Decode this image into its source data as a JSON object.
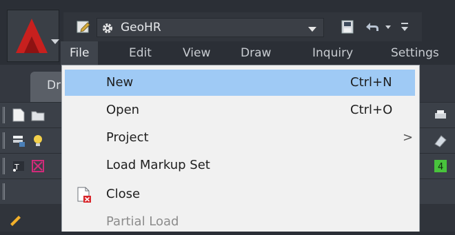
{
  "app": {
    "logo_icon": "autocad-a-icon",
    "accent_color": "#c8201e"
  },
  "quick_access": {
    "workspace": "GeoHR",
    "icons": [
      "document-edit-icon",
      "gear-icon",
      "save-icon",
      "undo-icon",
      "customize-icon"
    ]
  },
  "menubar": {
    "items": [
      {
        "label": "File"
      },
      {
        "label": "Edit"
      },
      {
        "label": "View"
      },
      {
        "label": "Draw"
      },
      {
        "label": "Inquiry"
      },
      {
        "label": "Settings"
      }
    ]
  },
  "tab": {
    "label": "Dr"
  },
  "file_menu": {
    "items": [
      {
        "label": "New",
        "shortcut": "Ctrl+N"
      },
      {
        "label": "Open",
        "shortcut": "Ctrl+O"
      },
      {
        "label": "Project",
        "submenu_arrow": ">"
      },
      {
        "label": "Load Markup Set"
      },
      {
        "label": "Close",
        "icon": "close-drawing-icon"
      },
      {
        "label": "Partial Load"
      }
    ],
    "highlight_color": "#9fcaf5"
  }
}
